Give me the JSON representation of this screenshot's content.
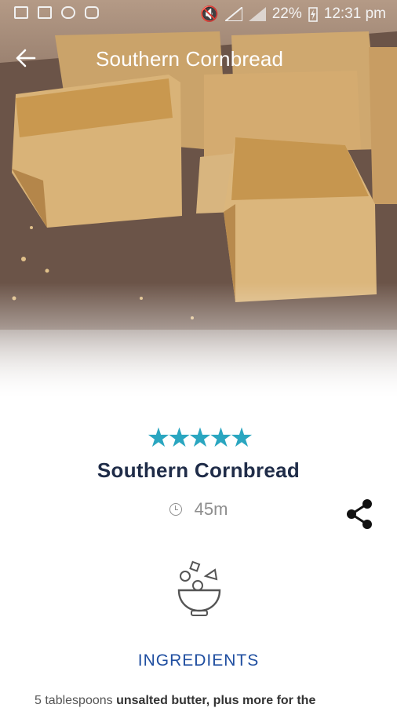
{
  "status_bar": {
    "battery": "22%",
    "time": "12:31 pm"
  },
  "app_bar": {
    "title": "Southern Cornbread"
  },
  "recipe": {
    "rating_stars": 5,
    "rating_display": "★★★★★",
    "name": "Southern Cornbread",
    "time": "45m"
  },
  "section": {
    "ingredients_heading": "INGREDIENTS"
  },
  "ingredients": {
    "first_line_amount": "5 tablespoons",
    "first_line_item": "unsalted butter, plus more for the"
  },
  "colors": {
    "accent": "#2aa6c0",
    "title": "#1f2c48",
    "section": "#1f4ea0"
  },
  "icons": [
    "back-arrow-icon",
    "clock-icon",
    "share-icon",
    "salad-bowl-icon"
  ]
}
